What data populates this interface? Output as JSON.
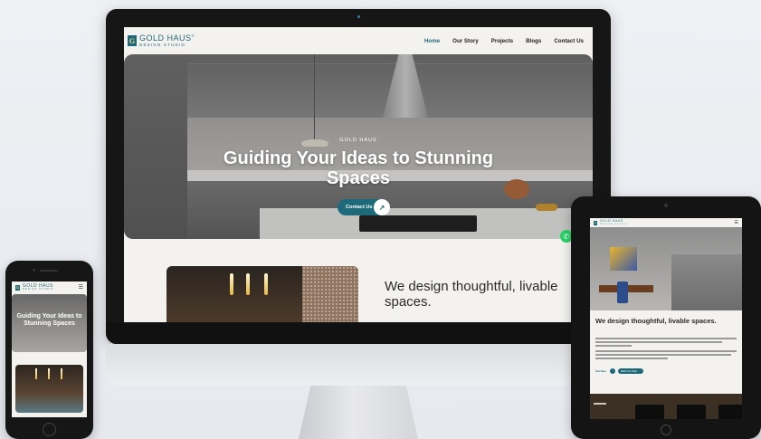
{
  "brand": {
    "name": "GOLD HAUS",
    "reg": "®",
    "tagline": "DESIGN STUDIO",
    "mark": "G"
  },
  "colors": {
    "accent": "#1f6a7a",
    "whatsapp": "#25d366",
    "page_bg": "#f3f2ee"
  },
  "desktop": {
    "nav": [
      {
        "label": "Home",
        "active": true
      },
      {
        "label": "Our Story"
      },
      {
        "label": "Projects"
      },
      {
        "label": "Blogs"
      },
      {
        "label": "Contact Us"
      }
    ],
    "hero": {
      "eyebrow": "GOLD HAUS",
      "title": "Guiding Your Ideas to Stunning Spaces",
      "cta_label": "Contact Us",
      "cta_icon": "arrow-up-right-icon"
    },
    "about_title": "We design thoughtful, livable spaces.",
    "whatsapp_icon": "whatsapp-icon"
  },
  "tablet": {
    "about_title": "We design thoughtful, livable spaces.",
    "btn_more": "View More",
    "btn_video": "Watch Our Video",
    "menu_icon": "hamburger-icon"
  },
  "phone": {
    "hero_title": "Guiding Your Ideas to Stunning Spaces",
    "menu_icon": "hamburger-icon"
  }
}
